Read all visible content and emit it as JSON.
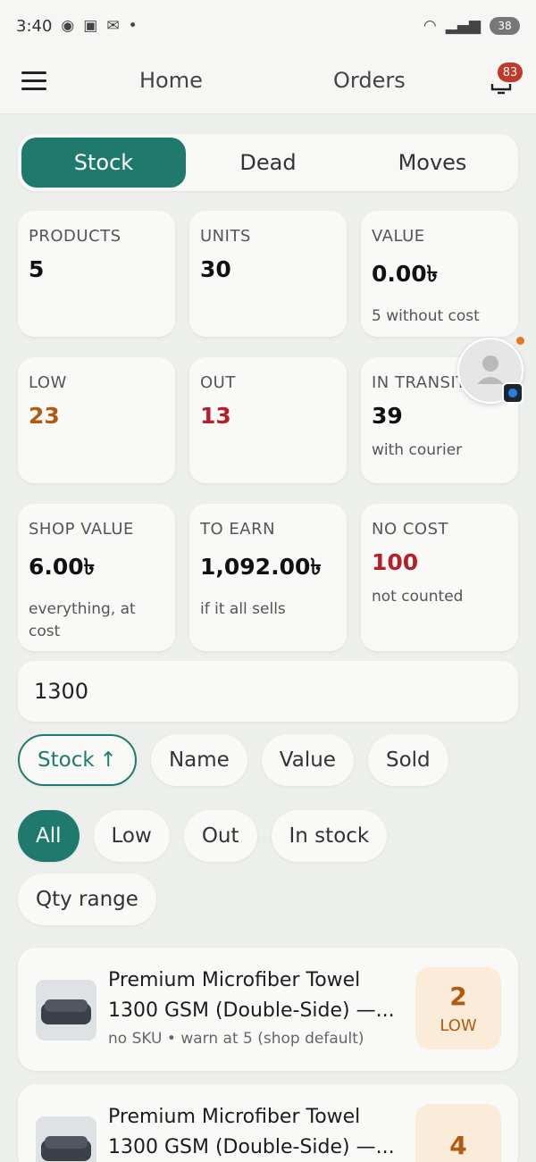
{
  "status_bar": {
    "time": "3:40",
    "battery": "38"
  },
  "top_nav": {
    "home": "Home",
    "orders": "Orders",
    "orders_badge": "83"
  },
  "tabs": [
    "Stock",
    "Dead",
    "Moves"
  ],
  "stats": [
    {
      "label": "PRODUCTS",
      "value": "5",
      "sub": ""
    },
    {
      "label": "UNITS",
      "value": "30",
      "sub": ""
    },
    {
      "label": "VALUE",
      "value": "0.00৳",
      "sub": "5 without cost"
    },
    {
      "label": "LOW",
      "value": "23",
      "sub": ""
    },
    {
      "label": "OUT",
      "value": "13",
      "sub": ""
    },
    {
      "label": "IN TRANSIT",
      "value": "39",
      "sub": "with courier"
    },
    {
      "label": "SHOP VALUE",
      "value": "6.00৳",
      "sub": "everything, at cost"
    },
    {
      "label": "TO EARN",
      "value": "1,092.00৳",
      "sub": "if it all sells"
    },
    {
      "label": "NO COST",
      "value": "100",
      "sub": "not counted"
    }
  ],
  "search": {
    "value": "1300"
  },
  "sort_chips": {
    "stock": "Stock",
    "stock_arrow": "↑",
    "name": "Name",
    "value": "Value",
    "sold": "Sold"
  },
  "filter_chips": {
    "all": "All",
    "low": "Low",
    "out": "Out",
    "in_stock": "In stock",
    "qty_range": "Qty range"
  },
  "products": [
    {
      "name": "Premium Microfiber Towel 1300 GSM (Double-Side) —...",
      "meta": "no SKU • warn at 5 (shop default)",
      "qty": "2",
      "tag": "LOW"
    },
    {
      "name": "Premium Microfiber Towel 1300 GSM (Double-Side) —...",
      "meta": "",
      "qty": "4",
      "tag": ""
    }
  ],
  "colors": {
    "accent": "#1f7a6d",
    "low": "#b35a12",
    "out": "#b3202a",
    "badge": "#c0392b"
  }
}
